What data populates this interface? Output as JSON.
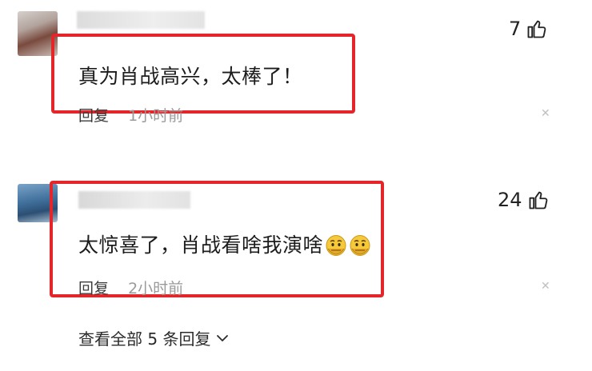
{
  "comments": [
    {
      "text": "真为肖战高兴，太棒了！",
      "reply_label": "回复",
      "time": "1小时前",
      "likes": "7"
    },
    {
      "text": "太惊喜了，肖战看啥我演啥",
      "reply_label": "回复",
      "time": "2小时前",
      "likes": "24"
    }
  ],
  "view_all_label": "查看全部 5 条回复",
  "colors": {
    "highlight": "#e4262b",
    "emoji": "#f5c93a"
  },
  "icons": [
    "thumbs-up-icon",
    "close-icon",
    "chevron-down-icon",
    "sweat-emoji-icon"
  ]
}
